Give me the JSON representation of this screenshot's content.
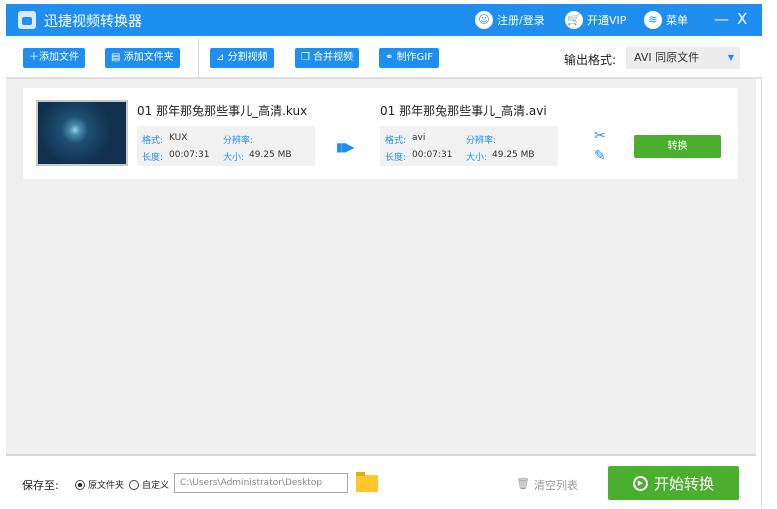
{
  "app": {
    "title": "迅捷视频转换器",
    "login": "注册/登录",
    "vip": "开通VIP",
    "menu": "菜单",
    "minimize": "—",
    "close": "X"
  },
  "toolbar": {
    "add_file": "添加文件",
    "add_folder": "添加文件夹",
    "split": "分割视频",
    "merge": "合并视频",
    "gif": "制作GIF",
    "format_label": "输出格式:",
    "format_value": "AVI  同原文件"
  },
  "files": [
    {
      "source": {
        "name": "01 那年那兔那些事儿_高清.kux",
        "format_label": "格式:",
        "format": "KUX",
        "res_label": "分辨率:",
        "res": "",
        "duration_label": "长度:",
        "duration": "00:07:31",
        "size_label": "大小:",
        "size": "49.25 MB"
      },
      "output": {
        "name": "01 那年那兔那些事儿_高清.avi",
        "format_label": "格式:",
        "format": "avi",
        "res_label": "分辨率:",
        "res": "",
        "duration_label": "长度:",
        "duration": "00:07:31",
        "size_label": "大小:",
        "size": "49.25 MB"
      },
      "convert_label": "转换"
    }
  ],
  "bottom": {
    "save_label": "保存至:",
    "opt_original": "原文件夹",
    "opt_custom": "自定义",
    "path": "C:\\Users\\Administrator\\Desktop",
    "clear": "清空列表",
    "start": "开始转换"
  }
}
